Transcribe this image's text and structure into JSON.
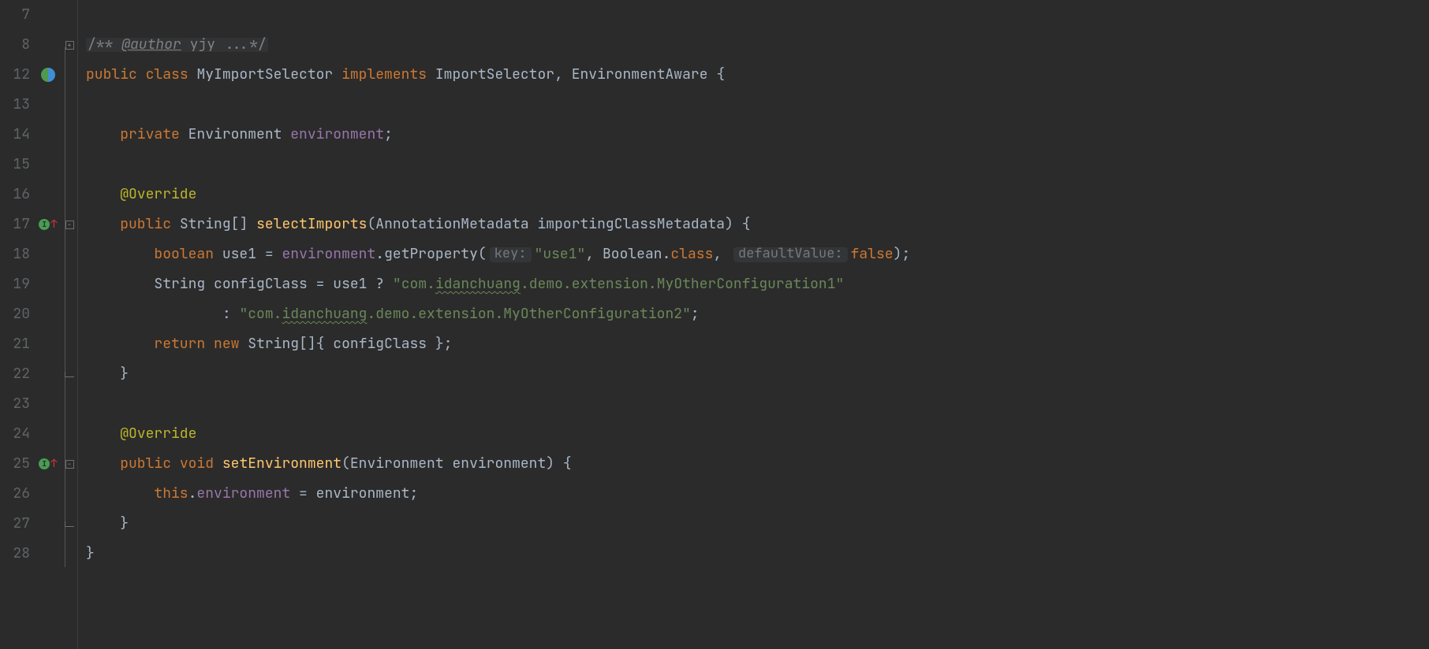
{
  "lines": {
    "ln7": "7",
    "ln8": "8",
    "ln12": "12",
    "ln13": "13",
    "ln14": "14",
    "ln15": "15",
    "ln16": "16",
    "ln17": "17",
    "ln18": "18",
    "ln19": "19",
    "ln20": "20",
    "ln21": "21",
    "ln22": "22",
    "ln23": "23",
    "ln24": "24",
    "ln25": "25",
    "ln26": "26",
    "ln27": "27",
    "ln28": "28"
  },
  "l8": {
    "open": "/** ",
    "tag": "@author",
    "rest": " yjy ...*/"
  },
  "l12": {
    "public": "public",
    "class": "class",
    "name": "MyImportSelector",
    "implements": "implements",
    "iface1": "ImportSelector",
    "comma": ",",
    "iface2": "EnvironmentAware",
    "brace": "{"
  },
  "l14": {
    "private": "private",
    "type": "Environment",
    "field": "environment",
    "semi": ";"
  },
  "l16": {
    "ann": "@Override"
  },
  "l17": {
    "public": "public",
    "ret": "String",
    "arr": "[]",
    "name": "selectImports",
    "po": "(",
    "pt": "AnnotationMetadata",
    "pn": "importingClassMetadata",
    "pc": ")",
    "brace": "{"
  },
  "l18": {
    "bool": "boolean",
    "v": "use1",
    "eq": "=",
    "fld": "environment",
    "dot": ".",
    "m": "getProperty",
    "po": "(",
    "h1": "key:",
    "s1": "\"use1\"",
    "c1": ",",
    "bx": "Boolean",
    "d2": ".",
    "cls": "class",
    "c2": ",",
    "h2": "defaultValue:",
    "kw": "false",
    "pc": ")",
    "semi": ";"
  },
  "l19": {
    "t": "String",
    "v": "configClass",
    "eq": "=",
    "u": "use1",
    "q": "?",
    "s_open": "\"",
    "s_p1": "com.",
    "s_u": "idanchuang",
    "s_p2": ".demo.extension.MyOtherConfiguration1",
    "s_close": "\""
  },
  "l20": {
    "colon": ":",
    "s_open": "\"",
    "s_p1": "com.",
    "s_u": "idanchuang",
    "s_p2": ".demo.extension.MyOtherConfiguration2",
    "s_close": "\"",
    "semi": ";"
  },
  "l21": {
    "ret": "return",
    "new": "new",
    "t": "String",
    "arr": "[]",
    "bo": "{",
    "v": "configClass",
    "bc": "}",
    "semi": ";"
  },
  "l22": {
    "brace": "}"
  },
  "l24": {
    "ann": "@Override"
  },
  "l25": {
    "public": "public",
    "void": "void",
    "name": "setEnvironment",
    "po": "(",
    "pt": "Environment",
    "pn": "environment",
    "pc": ")",
    "brace": "{"
  },
  "l26": {
    "this": "this",
    "dot": ".",
    "fld": "environment",
    "eq": "=",
    "p": "environment",
    "semi": ";"
  },
  "l27": {
    "brace": "}"
  },
  "l28": {
    "brace": "}"
  },
  "fold": {
    "plus": "+",
    "minus": "−"
  }
}
